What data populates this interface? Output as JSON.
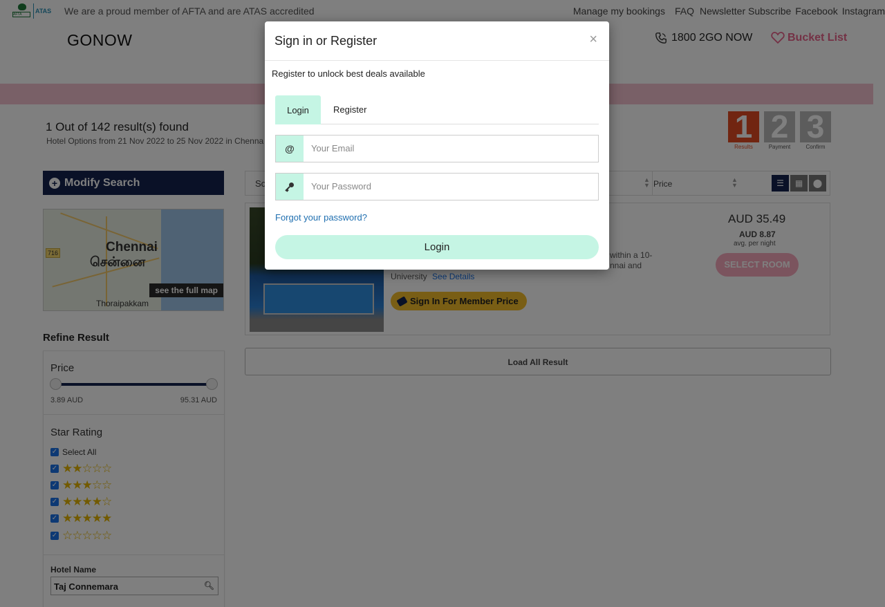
{
  "topbar": {
    "afta_logo": "AFTA",
    "atas_logo": "ATAS",
    "proud_text": "We are a proud member of AFTA and are ATAS accredited",
    "links": [
      "Manage my bookings",
      "FAQ",
      "Newsletter Subscribe",
      "Facebook",
      "Instagram"
    ]
  },
  "header": {
    "brand": "GONOW",
    "phone": "1800 2GO NOW",
    "bucket_list": "Bucket List"
  },
  "results": {
    "title": "1 Out of 142 result(s) found",
    "subtitle": "Hotel Options from  21 Nov 2022 to 25 Nov 2022 in Chenna"
  },
  "steps": [
    {
      "num": "1",
      "label": "Results"
    },
    {
      "num": "2",
      "label": "Payment"
    },
    {
      "num": "3",
      "label": "Confirm"
    }
  ],
  "sidebar": {
    "modify_label": "Modify Search",
    "map": {
      "city_en": "Chennai",
      "city_ta": "சென்னை",
      "area": "Thoraipakkam",
      "route_shield": "716",
      "full_map_label": "see the full map"
    },
    "refine_title": "Refine Result",
    "price_title": "Price",
    "price_min": "3.89 AUD",
    "price_max": "95.31 AUD",
    "star_title": "Star Rating",
    "select_all": "Select All",
    "star_rows": [
      2,
      3,
      4,
      5,
      0
    ],
    "hotel_name_title": "Hotel Name",
    "hotel_name_value": "Taj Connemara"
  },
  "sortbar": {
    "sort_label": "So",
    "price_label": "Price"
  },
  "hotel_card": {
    "desc_line1": "within a 10-",
    "desc_line2": "nnai and",
    "university": "University",
    "see_details": "See Details",
    "member_price": "Sign In For Member Price",
    "price_total": "AUD 35.49",
    "price_night": "AUD 8.87",
    "avg_label": "avg. per night",
    "select_room": "SELECT ROOM"
  },
  "load_all": "Load All Result",
  "modal": {
    "title": "Sign in or Register",
    "close": "×",
    "subtitle": "Register to unlock best deals available",
    "tab_login": "Login",
    "tab_register": "Register",
    "email_icon": "@",
    "email_placeholder": "Your Email",
    "password_placeholder": "Your Password",
    "forgot": "Forgot your password?",
    "login_button": "Login"
  },
  "colors": {
    "navy": "#14234f",
    "mint": "#c5f5e4",
    "pink": "#f3c0cf",
    "gold": "#f2bd2a",
    "step_active": "#e24b23"
  }
}
